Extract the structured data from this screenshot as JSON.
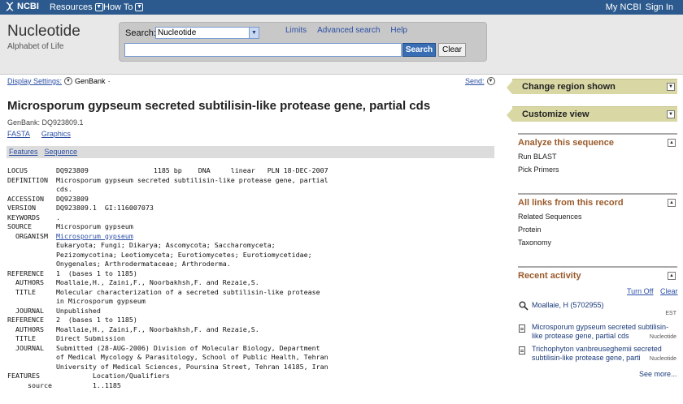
{
  "topbar": {
    "logo": "NCBI",
    "menus": [
      "Resources",
      "How To"
    ],
    "my_ncbi": "My NCBI",
    "sign_in": "Sign In"
  },
  "header": {
    "db_title": "Nucleotide",
    "tagline": "Alphabet of Life",
    "search_label": "Search:",
    "db_selected": "Nucleotide",
    "search_value": "",
    "search_button": "Search",
    "clear_button": "Clear",
    "links": [
      "Limits",
      "Advanced search",
      "Help"
    ]
  },
  "record_header": {
    "display_settings": "Display Settings:",
    "display_value": "GenBank",
    "send_to": "Send:",
    "title": "Microsporum gypseum secreted subtilisin-like protease gene, partial cds",
    "genbank_id": "GenBank: DQ923809.1",
    "formats": [
      "FASTA",
      "Graphics"
    ],
    "tabs": [
      "Features",
      "Sequence"
    ]
  },
  "record_lines": [
    "LOCUS       DQ923809                1185 bp    DNA     linear   PLN 18-DEC-2007",
    "DEFINITION  Microsporum gypseum secreted subtilisin-like protease gene, partial",
    "            cds.",
    "ACCESSION   DQ923809",
    "VERSION     DQ923809.1  GI:116007073",
    "KEYWORDS    .",
    "SOURCE      Microsporum gypseum",
    "  ORGANISM  Microsporum gypseum",
    "            Eukaryota; Fungi; Dikarya; Ascomycota; Saccharomyceta;",
    "            Pezizomycotina; Leotiomyceta; Eurotiomycetes; Eurotiomycetidae;",
    "            Onygenales; Arthrodermataceae; Arthroderma.",
    "REFERENCE   1  (bases 1 to 1185)",
    "  AUTHORS   Moallaie,H., Zaini,F., Noorbakhsh,F. and Rezaie,S.",
    "  TITLE     Molecular characterization of a secreted subtilisin-like protease",
    "            in Microsporum gypseum",
    "  JOURNAL   Unpublished",
    "REFERENCE   2  (bases 1 to 1185)",
    "  AUTHORS   Moallaie,H., Zaini,F., Noorbakhsh,F. and Rezaie,S.",
    "  TITLE     Direct Submission",
    "  JOURNAL   Submitted (28-AUG-2006) Division of Molecular Biology, Department",
    "            of Medical Mycology & Parasitology, School of Public Health, Tehran",
    "            University of Medical Sciences, Poursina Street, Tehran 14185, Iran",
    "FEATURES             Location/Qualifiers",
    "     source          1..1185"
  ],
  "organism_link": "Microsporum gypseum",
  "sidebar": {
    "bars": [
      "Change region shown",
      "Customize view"
    ],
    "analyze": {
      "title": "Analyze this sequence",
      "items": [
        "Run BLAST",
        "Pick Primers"
      ]
    },
    "links": {
      "title": "All links from this record",
      "items": [
        "Related Sequences",
        "Protein",
        "Taxonomy"
      ]
    },
    "recent": {
      "title": "Recent activity",
      "turn_off": "Turn Off",
      "clear": "Clear",
      "search_item": "Moallaie, H (5702955)",
      "search_db": "EST",
      "docs": [
        {
          "line1": "Microsporum gypseum secreted subtilisin-",
          "line2": "like protease gene, partial cds",
          "db": "Nucleotide"
        },
        {
          "line1": "Trichophyton vanbreuseghemii secreted",
          "line2": "subtilisin-like protease gene, parti",
          "db": "Nucleotide"
        }
      ],
      "see_more": "See more..."
    }
  }
}
